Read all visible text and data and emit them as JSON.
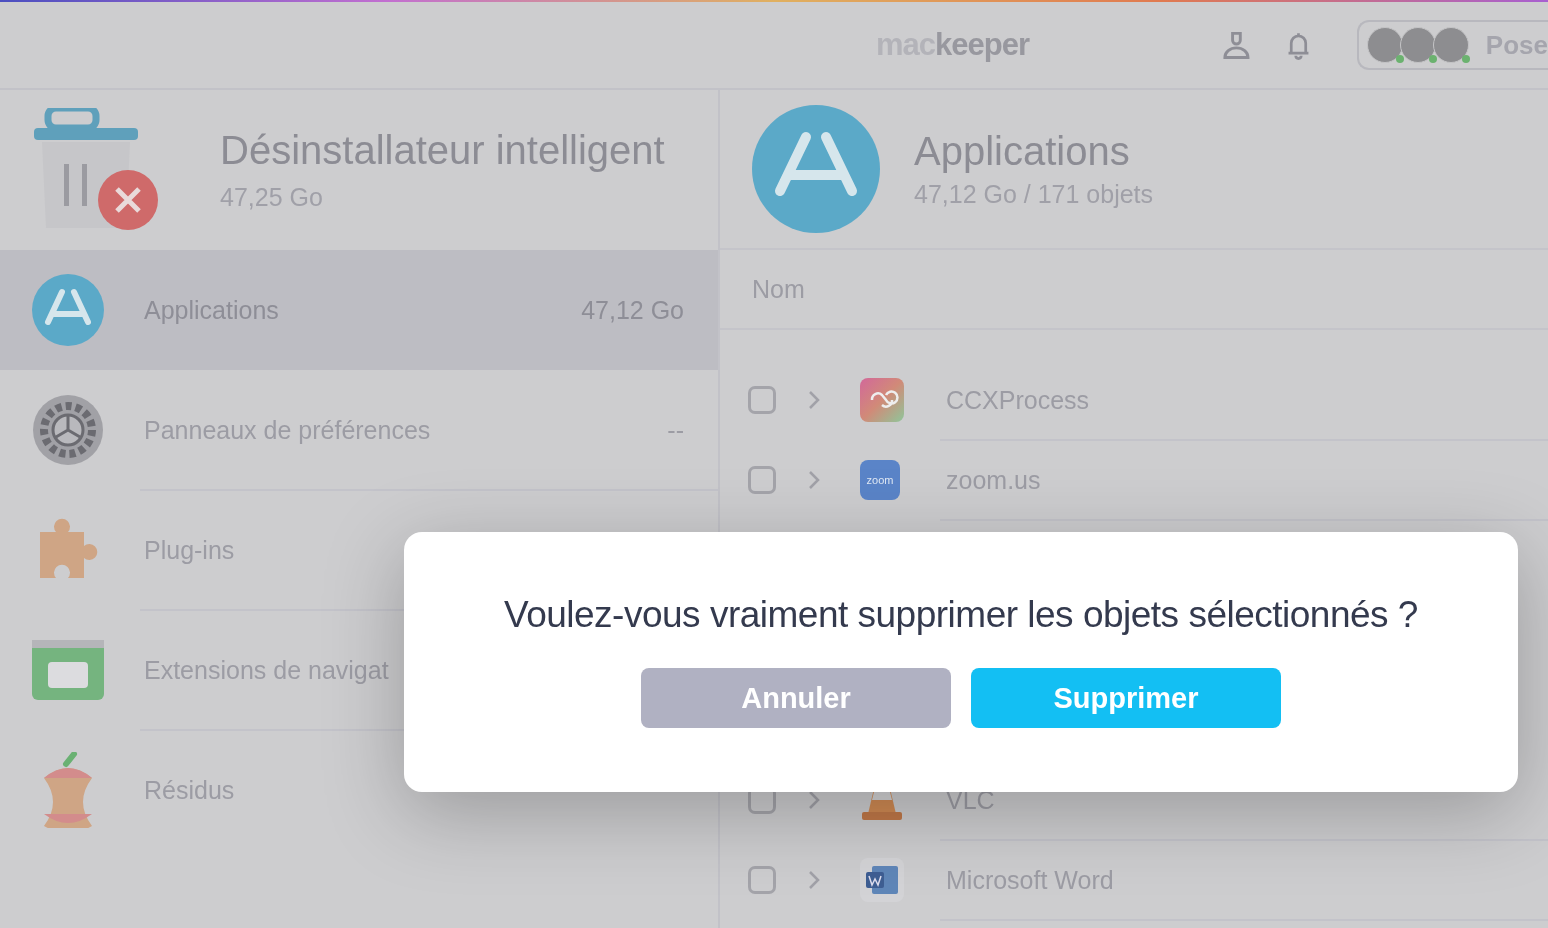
{
  "top_bar": {
    "logo": {
      "light": "mac",
      "dark": "keeper"
    },
    "account_label": "Pose"
  },
  "sidebar": {
    "title": "Désinstallateur intelligent",
    "size": "47,25 Go",
    "items": [
      {
        "kind": "apps",
        "label": "Applications",
        "size": "47,12 Go",
        "selected": true
      },
      {
        "kind": "prefs",
        "label": "Panneaux de préférences",
        "size": "--",
        "selected": false
      },
      {
        "kind": "plugins",
        "label": "Plug-ins",
        "selected": false
      },
      {
        "kind": "extensions",
        "label": "Extensions de navigat",
        "selected": false
      },
      {
        "kind": "leftovers",
        "label": "Résidus",
        "selected": false
      }
    ]
  },
  "content": {
    "title": "Applications",
    "subtitle": "47,12 Go / 171 objets",
    "column": "Nom",
    "rows": [
      {
        "kind": "cc",
        "name": "CCXProcess",
        "checked": false
      },
      {
        "kind": "zoom",
        "name": "zoom.us",
        "checked": false
      },
      {
        "kind": "vlc",
        "name": "VLC",
        "checked": false
      },
      {
        "kind": "word",
        "name": "Microsoft Word",
        "checked": false
      }
    ]
  },
  "dialog": {
    "message": "Voulez-vous vraiment supprimer les objets sélectionnés ?",
    "buttons": [
      {
        "kind": "cancel",
        "label": "Annuler"
      },
      {
        "kind": "confirm",
        "label": "Supprimer"
      }
    ]
  }
}
